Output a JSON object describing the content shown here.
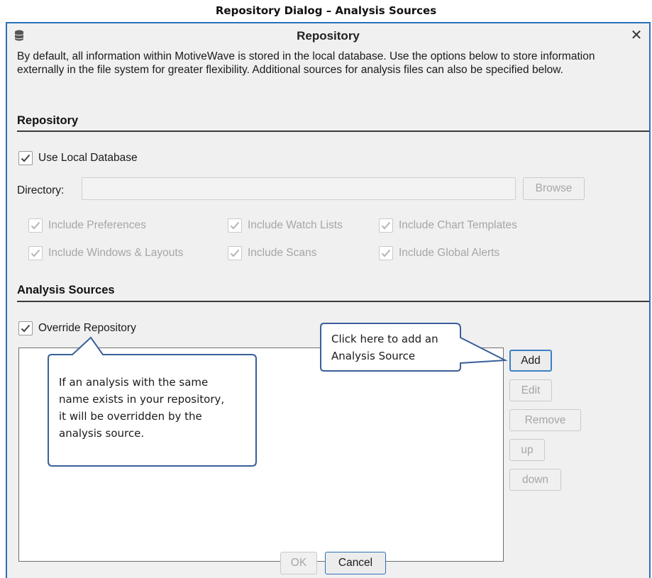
{
  "caption": "Repository Dialog – Analysis Sources",
  "window": {
    "title": "Repository",
    "icon": "database-icon",
    "close_icon": "close-icon"
  },
  "intro_text": "By default, all information within MotiveWave is stored in the local database.  Use the options below to store information externally in the file system for greater flexibility.  Additional sources for analysis files can also be specified below.",
  "repository_section": {
    "title": "Repository",
    "use_local_db": {
      "label": "Use Local Database",
      "checked": true
    },
    "directory": {
      "label": "Directory:",
      "value": "",
      "browse_label": "Browse"
    },
    "includes": [
      {
        "label": "Include Preferences",
        "checked": true
      },
      {
        "label": "Include Watch Lists",
        "checked": true
      },
      {
        "label": "Include Chart Templates",
        "checked": true
      },
      {
        "label": "Include Windows & Layouts",
        "checked": true
      },
      {
        "label": "Include Scans",
        "checked": true
      },
      {
        "label": "Include Global Alerts",
        "checked": true
      }
    ]
  },
  "analysis_section": {
    "title": "Analysis Sources",
    "override": {
      "label": "Override Repository",
      "checked": true
    },
    "buttons": {
      "add": "Add",
      "edit": "Edit",
      "remove": "Remove",
      "up": "up",
      "down": "down"
    }
  },
  "callouts": {
    "add_note": [
      "Click here to add an",
      "Analysis Source"
    ],
    "override_note": [
      "If an analysis with the same",
      "name exists in your repository,",
      "it will be overridden by the",
      "analysis source."
    ]
  },
  "footer": {
    "ok": "OK",
    "cancel": "Cancel"
  },
  "colors": {
    "window_border": "#2b6fb8",
    "callout_border": "#3a5f9a",
    "dialog_bg": "#f0f0f0"
  }
}
